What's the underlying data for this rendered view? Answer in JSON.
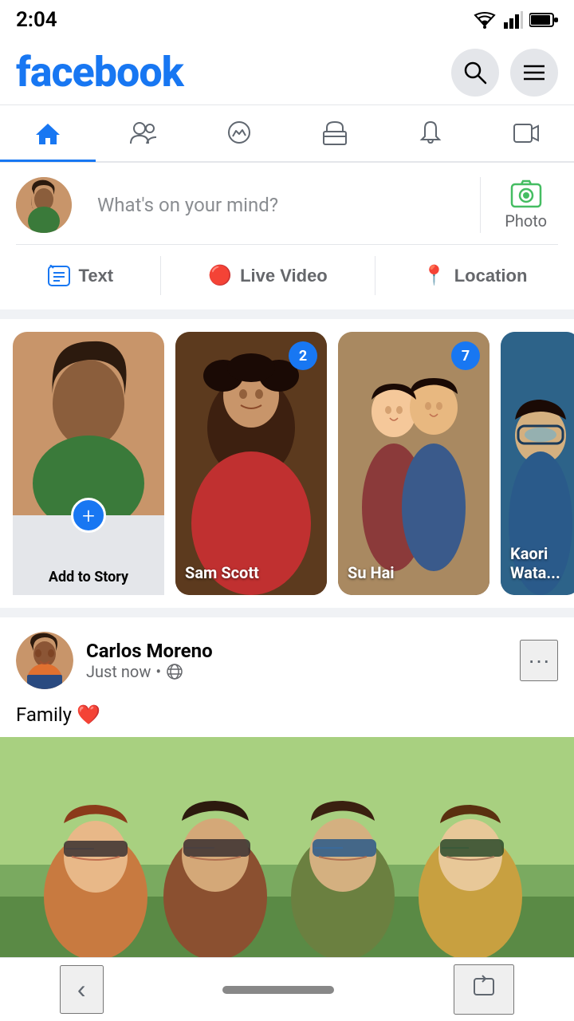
{
  "statusBar": {
    "time": "2:04",
    "wifiIcon": "wifi",
    "signalIcon": "signal",
    "batteryIcon": "battery"
  },
  "header": {
    "logo": "facebook",
    "searchLabel": "search",
    "menuLabel": "menu"
  },
  "nav": {
    "items": [
      {
        "id": "home",
        "label": "Home",
        "icon": "🏠",
        "active": true
      },
      {
        "id": "friends",
        "label": "Friends",
        "icon": "👥",
        "active": false
      },
      {
        "id": "messenger",
        "label": "Messenger",
        "icon": "💬",
        "active": false
      },
      {
        "id": "marketplace",
        "label": "Marketplace",
        "icon": "🏪",
        "active": false
      },
      {
        "id": "notifications",
        "label": "Notifications",
        "icon": "🔔",
        "active": false
      },
      {
        "id": "video",
        "label": "Video",
        "icon": "▶",
        "active": false
      }
    ]
  },
  "composer": {
    "placeholder": "What's on your mind?",
    "photoLabel": "Photo",
    "actions": [
      {
        "id": "text",
        "label": "Text",
        "iconColor": "#1877f2"
      },
      {
        "id": "live-video",
        "label": "Live Video",
        "iconColor": "#e02020"
      },
      {
        "id": "location",
        "label": "Location",
        "iconColor": "#e02020"
      }
    ]
  },
  "stories": [
    {
      "id": "add-story",
      "type": "add",
      "label": "Add to Story",
      "addIcon": "+"
    },
    {
      "id": "sam-scott",
      "type": "story",
      "name": "Sam Scott",
      "badge": "2",
      "colorClass": "story-sam"
    },
    {
      "id": "su-hai",
      "type": "story",
      "name": "Su Hai",
      "badge": "7",
      "colorClass": "story-su"
    },
    {
      "id": "kaori-wata",
      "type": "story",
      "name": "Kaori Wata...",
      "badge": "",
      "colorClass": "story-kaori"
    }
  ],
  "post": {
    "author": "Carlos Moreno",
    "time": "Just now",
    "privacy": "public",
    "text": "Family ❤️",
    "moreIcon": "•••"
  },
  "bottomNav": {
    "backIcon": "‹",
    "rotateIcon": "⇄"
  }
}
